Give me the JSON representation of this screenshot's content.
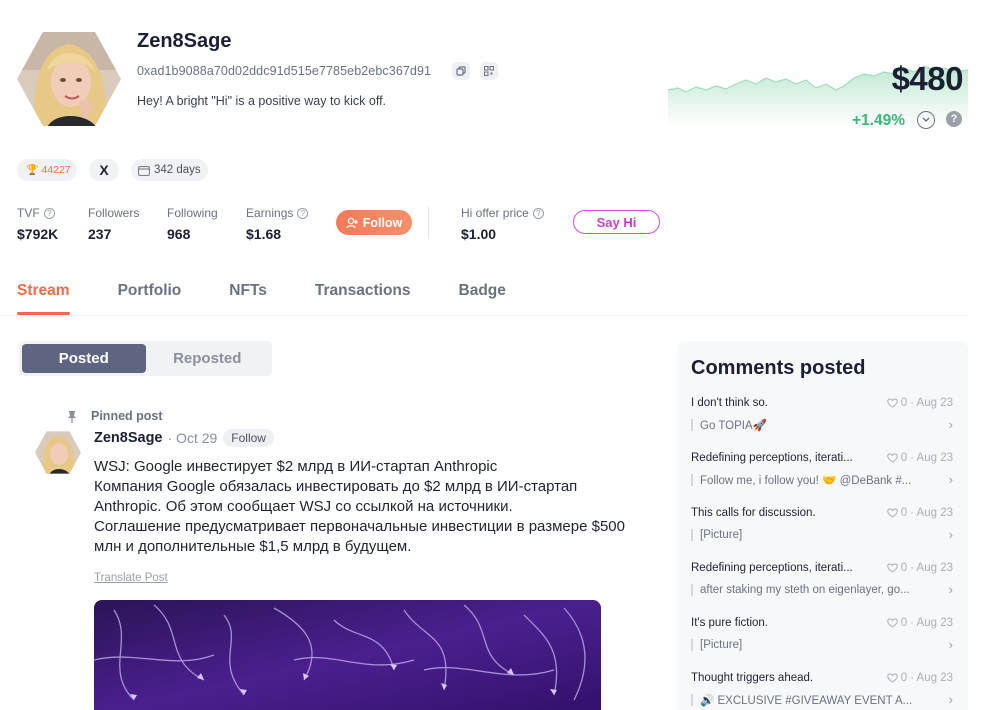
{
  "profile": {
    "name": "Zen8Sage",
    "address": "0xad1b9088a70d02ddc91d515e7785eb2ebc367d91",
    "bio": "Hey! A bright \"Hi\" is a positive way to kick off.",
    "price": "$480",
    "change": "+1.49%",
    "trophy_count": "44227",
    "x_label": "X",
    "days": "342 days"
  },
  "stats": {
    "tvf": {
      "label": "TVF",
      "value": "$792K"
    },
    "followers": {
      "label": "Followers",
      "value": "237"
    },
    "following": {
      "label": "Following",
      "value": "968"
    },
    "earnings": {
      "label": "Earnings",
      "value": "$1.68"
    },
    "hi_offer": {
      "label": "Hi offer price",
      "value": "$1.00"
    }
  },
  "buttons": {
    "follow": "Follow",
    "say_hi": "Say Hi"
  },
  "tabs": [
    "Stream",
    "Portfolio",
    "NFTs",
    "Transactions",
    "Badge"
  ],
  "segments": [
    "Posted",
    "Reposted"
  ],
  "post": {
    "pinned_label": "Pinned post",
    "author": "Zen8Sage",
    "date": "· Oct 29",
    "follow": "Follow",
    "body_lines": [
      "WSJ: Google инвестирует $2 млрд в ИИ-стартап Anthropic",
      "Компания Google обязалась инвестировать до $2 млрд в ИИ-стартап Anthropic. Об этом сообщает WSJ со ссылкой на источники.",
      "Соглашение предусматривает первоначальные инвестиции в размере $500 млн и дополнительные $1,5 млрд в будущем."
    ],
    "translate": "Translate Post"
  },
  "comments": {
    "title": "Comments posted",
    "items": [
      {
        "text": "I don't think so.",
        "likes": "0",
        "date": "· Aug 23",
        "sub": "Go TOPIA🚀"
      },
      {
        "text": "Redefining perceptions, iterati...",
        "likes": "0",
        "date": "· Aug 23",
        "sub": "Follow me, i follow you! 🤝 @DeBank #..."
      },
      {
        "text": "This calls for discussion.",
        "likes": "0",
        "date": "· Aug 23",
        "sub": "[Picture]"
      },
      {
        "text": "Redefining perceptions, iterati...",
        "likes": "0",
        "date": "· Aug 23",
        "sub": "after staking my steth on eigenlayer, go..."
      },
      {
        "text": "It's pure fiction.",
        "likes": "0",
        "date": "· Aug 23",
        "sub": "[Picture]"
      },
      {
        "text": "Thought triggers ahead.",
        "likes": "0",
        "date": "· Aug 23",
        "sub": "🔊 EXCLUSIVE #GIVEAWAY EVENT A..."
      }
    ]
  },
  "colors": {
    "accent": "#f26b4e",
    "positive": "#3cb57c",
    "sayhi": "#d64fd2",
    "active_segment": "#5f6580"
  }
}
